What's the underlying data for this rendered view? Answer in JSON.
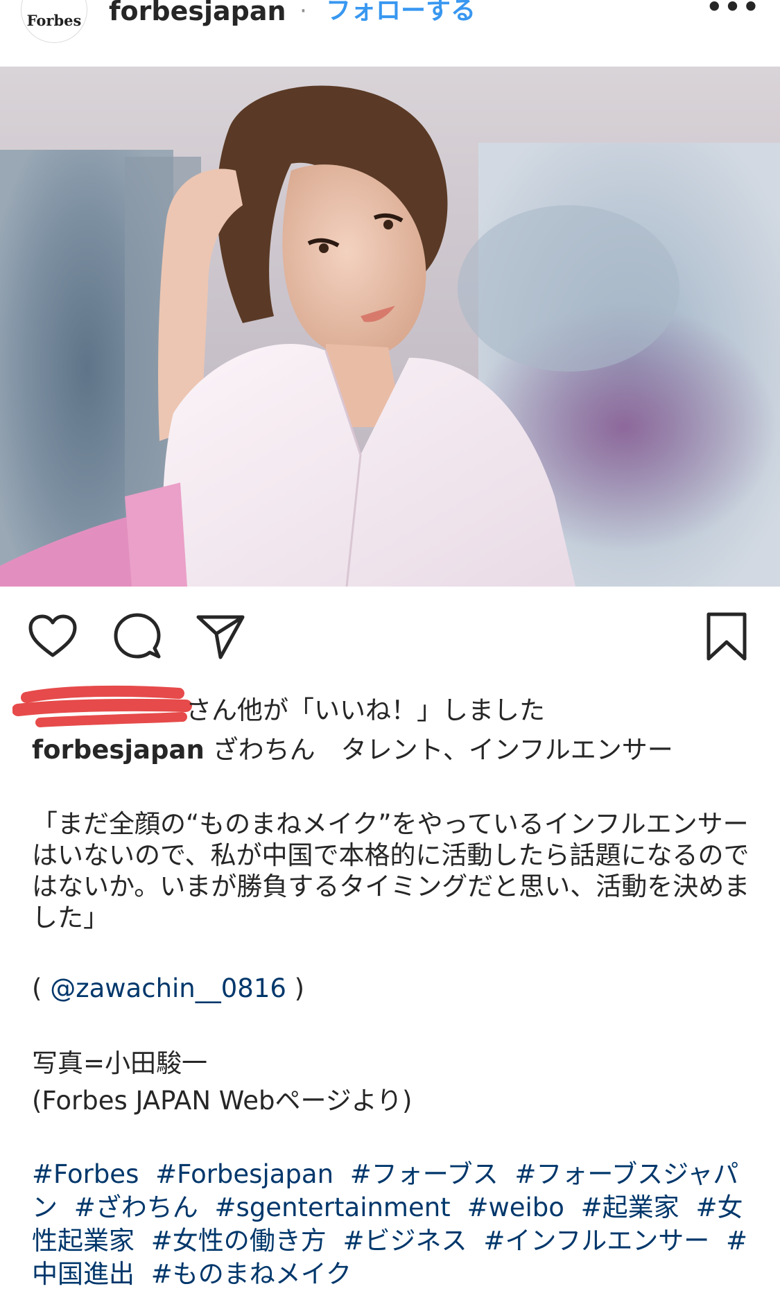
{
  "header": {
    "avatar_text": "Forbes",
    "username": "forbesjapan",
    "separator": "·",
    "follow_label": "フォローする",
    "more_label": "•••"
  },
  "photo": {
    "description_icon": "portrait-photo"
  },
  "actions": {
    "icons": [
      "heart-icon",
      "comment-icon",
      "share-icon",
      "bookmark-icon"
    ]
  },
  "likes": {
    "suffix": "さん他が「いいね！」しました"
  },
  "caption": {
    "username": "forbesjapan",
    "headline": " ざわちん　タレント、インフルエンサー"
  },
  "quote": {
    "text": "「まだ全顔の“ものまねメイク”をやっているインフルエンサーはいないので、私が中国で本格的に活動したら話題になるのではないか。いまが勝負するタイミングだと思い、活動を決めました」"
  },
  "mention": {
    "open": "( ",
    "handle": "@zawachin__0816",
    "close": " )"
  },
  "credit": {
    "photo": "写真=小田駿一",
    "source": "(Forbes JAPAN Webページより)"
  },
  "hashtags": [
    "#Forbes",
    "#Forbesjapan",
    "#フォーブス",
    "#フォーブスジャパン",
    "#ざわちん",
    "#sgentertainment",
    "#weibo",
    "#起業家",
    "#女性起業家",
    "#女性の働き方",
    "#ビジネス",
    "#インフルエンサー",
    "#中国進出",
    "#ものまねメイク"
  ],
  "colors": {
    "link": "#00376b",
    "follow": "#3897f0",
    "text": "#262626"
  }
}
